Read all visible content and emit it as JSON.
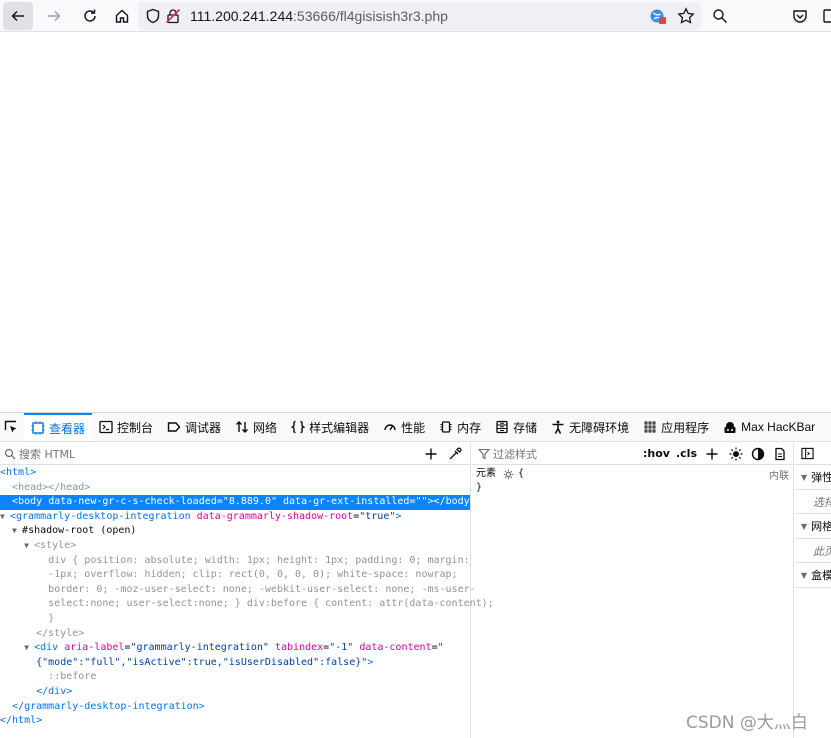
{
  "browser": {
    "url_host": "111.200.241.244",
    "url_rest": ":53666/fl4gisisish3r3.php"
  },
  "devtools": {
    "tabs": [
      {
        "label": "查看器",
        "icon": "inspector-icon"
      },
      {
        "label": "控制台",
        "icon": "console-icon"
      },
      {
        "label": "调试器",
        "icon": "debugger-icon"
      },
      {
        "label": "网络",
        "icon": "network-icon"
      },
      {
        "label": "样式编辑器",
        "icon": "style-editor-icon"
      },
      {
        "label": "性能",
        "icon": "performance-icon"
      },
      {
        "label": "内存",
        "icon": "memory-icon"
      },
      {
        "label": "存储",
        "icon": "storage-icon"
      },
      {
        "label": "无障碍环境",
        "icon": "accessibility-icon"
      },
      {
        "label": "应用程序",
        "icon": "application-icon"
      },
      {
        "label": "Max HacKBar",
        "icon": "hackbar-icon"
      }
    ],
    "markup": {
      "search_placeholder": "搜索 HTML",
      "lines": [
        {
          "html": "<span class=\"tg\">&lt;html&gt;</span>"
        },
        {
          "html": "  <span class=\"dim\">&lt;head&gt;&lt;/head&gt;</span>"
        },
        {
          "html": "  <span class=\"tg\">&lt;body</span> <span class=\"an\">data-new-gr-c-s-check-loaded</span>=<span class=\"av\">\"8.889.0\"</span> <span class=\"an\">data-gr-ext-installed</span>=<span class=\"av\">\"\"</span><span class=\"tg\">&gt;&lt;/body&gt;</span>",
          "selected": true
        },
        {
          "html": "<span class=\"tw\">▼</span><span class=\"tg\">&lt;grammarly-desktop-integration</span> <span class=\"an\">data-grammarly-shadow-root</span>=<span class=\"av\">\"true\"</span><span class=\"tg\">&gt;</span>"
        },
        {
          "html": "  <span class=\"tw\">▼</span>#shadow-root (open)"
        },
        {
          "html": "    <span class=\"tw\">▼</span><span class=\"dim\">&lt;style&gt;</span>"
        },
        {
          "html": "        <span class=\"dim\">div { position: absolute; width: 1px; height: 1px; padding: 0; margin:</span>"
        },
        {
          "html": "        <span class=\"dim\">-1px; overflow: hidden; clip: rect(0, 0, 0, 0); white-space: nowrap;</span>"
        },
        {
          "html": "        <span class=\"dim\">border: 0; -moz-user-select: none; -webkit-user-select: none; -ms-user-</span>"
        },
        {
          "html": "        <span class=\"dim\">select:none; user-select:none; } div:before { content: attr(data-content);</span>"
        },
        {
          "html": "        <span class=\"dim\">}</span>"
        },
        {
          "html": "      <span class=\"dim\">&lt;/style&gt;</span>"
        },
        {
          "html": "    <span class=\"tw\">▼</span><span class=\"tg\">&lt;div</span> <span class=\"an\">aria-label</span>=<span class=\"av\">\"grammarly-integration\"</span> <span class=\"an\">tabindex</span>=<span class=\"av\">\"-1\"</span> <span class=\"an\">data-content</span>=<span class=\"av\">\"</span>"
        },
        {
          "html": "      <span class=\"av\">{\"mode\":\"full\",\"isActive\":true,\"isUserDisabled\":false}\"</span><span class=\"tg\">&gt;</span>"
        },
        {
          "html": "        <span class=\"dim\">::before</span>"
        },
        {
          "html": "      <span class=\"tg\">&lt;/div&gt;</span>"
        },
        {
          "html": "  <span class=\"tg\">&lt;/grammarly-desktop-integration&gt;</span>"
        },
        {
          "html": "<span class=\"tg\">&lt;/html&gt;</span>"
        }
      ]
    },
    "rules": {
      "filter_placeholder": "过滤样式",
      "hov": ":hov",
      "cls": ".cls",
      "element_label": "元素",
      "open_brace": "{",
      "close_brace": "}",
      "inline_label": "内联"
    },
    "layout": {
      "sections": [
        {
          "title": "弹性",
          "body": "选择"
        },
        {
          "title": "网格",
          "body": "此页"
        },
        {
          "title": "盒模",
          "body": ""
        }
      ]
    }
  },
  "watermark": "CSDN @大灬白",
  "colors": {
    "accent": "#0a84ff",
    "selection": "#0a84ff",
    "tag": "#0074e8",
    "attr_name": "#dd00a9",
    "attr_value": "#003eaa"
  }
}
